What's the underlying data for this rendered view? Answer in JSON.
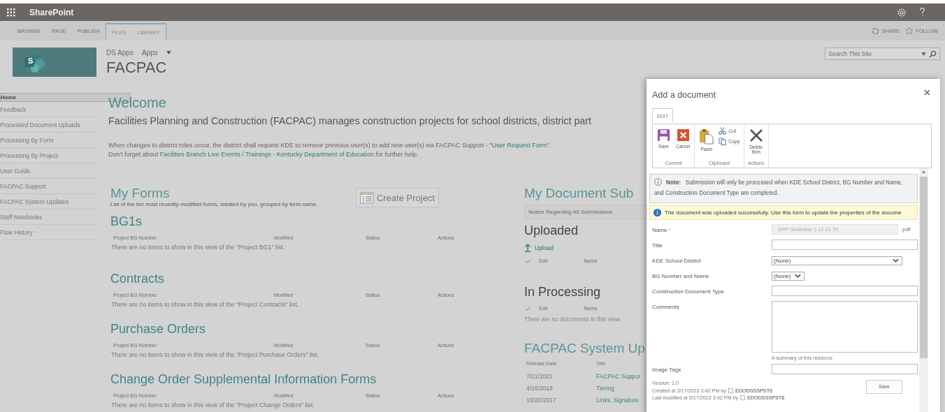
{
  "suite_bar": {
    "app_name": "SharePoint"
  },
  "ribbon_tabs": [
    {
      "label": "BROWSE",
      "kind": "standard"
    },
    {
      "label": "PAGE",
      "kind": "standard"
    },
    {
      "label": "PUBLISH",
      "kind": "standard"
    },
    {
      "label": "FILES",
      "kind": "contextual"
    },
    {
      "label": "LIBRARY",
      "kind": "contextual"
    }
  ],
  "ribbon_actions": [
    {
      "label": "SHARE",
      "kind": "share"
    },
    {
      "label": "FOLLOW",
      "kind": "follow"
    }
  ],
  "site": {
    "breadcrumbs": [
      "DS Apps",
      "Apps"
    ],
    "title": "FACPAC",
    "logo_letter": "S"
  },
  "search": {
    "placeholder": "Search This Site"
  },
  "nav": [
    {
      "label": "Home",
      "selected": true
    },
    {
      "label": "Feedback",
      "selected": false
    },
    {
      "label": "Processed Document Uploads",
      "selected": false
    },
    {
      "label": "Processing By Form",
      "selected": false
    },
    {
      "label": "Processing By Project",
      "selected": false
    },
    {
      "label": "User Guide",
      "selected": false
    },
    {
      "label": "FACPAC Support",
      "selected": false
    },
    {
      "label": "FACPAC System Updates",
      "selected": false
    },
    {
      "label": "Staff Notebooks",
      "selected": false
    },
    {
      "label": "Flow History",
      "selected": false
    }
  ],
  "welcome": {
    "heading": "Welcome",
    "intro": "Facilities Planning and Construction (FACPAC) manages construction projects for school districts, district part",
    "lines": [
      [
        {
          "text": "When changes to district roles occur, the district shall request KDE to remove previous user(s) to add new user(s) via FACPAC Support - ",
          "link": false
        },
        {
          "text": "\"User Request Form\".",
          "link": true
        }
      ],
      [
        {
          "text": "Don't forget about ",
          "link": false
        },
        {
          "text": "Facilities Branch Live Events / Trainings - Kentucky Department of Education",
          "link": true
        },
        {
          "text": " for further help.",
          "link": false
        }
      ]
    ]
  },
  "my_forms": {
    "heading": "My Forms",
    "description": "List of the ten most recently modified forms, created by you, grouped by form name.",
    "create_button": "Create Project",
    "lists": [
      {
        "title": "BG1s",
        "columns": [
          "Project BG Number",
          "Modified",
          "Status",
          "Actions"
        ],
        "empty": "There are no items to show in this view of the \"Project BG1\" list."
      },
      {
        "title": "Contracts",
        "columns": [
          "Project BG Number",
          "Modified",
          "Status",
          "Actions"
        ],
        "empty": "There are no items to show in this view of the \"Project Contracts\" list."
      },
      {
        "title": "Purchase Orders",
        "columns": [
          "Project BG Number",
          "Modified",
          "Status",
          "Actions"
        ],
        "empty": "There are no items to show in this view of the \"Project Purchase Orders\" list."
      },
      {
        "title": "Change Order Supplemental Information Forms",
        "columns": [
          "Project BG Number",
          "Modified",
          "Status",
          "Actions"
        ],
        "empty": "There are no items to show in this view of the \"Project Change Orders\" list."
      }
    ]
  },
  "documents": {
    "heading": "My Document Sub",
    "notice": "Notice Regarding All Submissions",
    "uploaded": {
      "heading": "Uploaded",
      "upload": "Upload",
      "columns": [
        "Edit",
        "Name"
      ]
    },
    "processing": {
      "heading": "In Processing",
      "columns": [
        "Edit",
        "Name"
      ],
      "empty": "There are no documents in this view."
    }
  },
  "updates": {
    "heading": "FACPAC System Up",
    "columns": [
      "Release Date",
      "Title"
    ],
    "rows": [
      {
        "date": "7/21/2021",
        "title": "FACPAC Suppor"
      },
      {
        "date": "4/16/2018",
        "title": "Tiering"
      },
      {
        "date": "10/20/2017",
        "title": "Links, Signature"
      }
    ]
  },
  "dialog": {
    "title": "Add a document",
    "ribbon_tab": "EDIT",
    "groups": [
      {
        "label": "Commit",
        "buttons": [
          {
            "label": "Save",
            "kind": "save"
          },
          {
            "label": "Cancel",
            "kind": "cancel"
          }
        ]
      },
      {
        "label": "Clipboard",
        "buttons": [
          {
            "label": "Paste",
            "kind": "paste"
          },
          {
            "label": "Cut",
            "kind": "cut"
          },
          {
            "label": "Copy",
            "kind": "copy"
          }
        ]
      },
      {
        "label": "Actions",
        "buttons": [
          {
            "label": "Delete Item",
            "kind": "delete"
          }
        ]
      }
    ],
    "note_label": "Note:",
    "note": "Submission will only be processed when KDE School District, BG Number and Name, and Construction Document Type are completed.",
    "banner": "The document was uploaded successfully. Use this form to update the properties of the docume",
    "fields": [
      {
        "label": "Name",
        "required_mark": "*",
        "kind": "text",
        "value": "DFP Guideline 1.12.23 TK",
        "suffix": ".pdf",
        "disabled": true
      },
      {
        "label": "Title",
        "kind": "text",
        "disabled": false
      },
      {
        "label": "KDE School District",
        "kind": "select",
        "value": "(None)",
        "disabled": false
      },
      {
        "label": "BG Number and Name",
        "kind": "compact-select",
        "value": "(None)",
        "disabled": false
      },
      {
        "label": "Construction Document Type",
        "kind": "text",
        "disabled": false
      },
      {
        "label": "Comments",
        "kind": "textarea",
        "hint": "A summary of this resource",
        "disabled": false
      },
      {
        "label": "Image Tags",
        "kind": "text",
        "disabled": false
      }
    ],
    "version": "Version: 1.0",
    "audit": [
      {
        "text": "Created at 3/17/2023 3:42 PM  by",
        "user": "EDODSSSPST6"
      },
      {
        "text": "Last modified at 3/17/2023 3:42 PM  by",
        "user": "EDODSSSPST6"
      }
    ],
    "save_button": "Save"
  }
}
